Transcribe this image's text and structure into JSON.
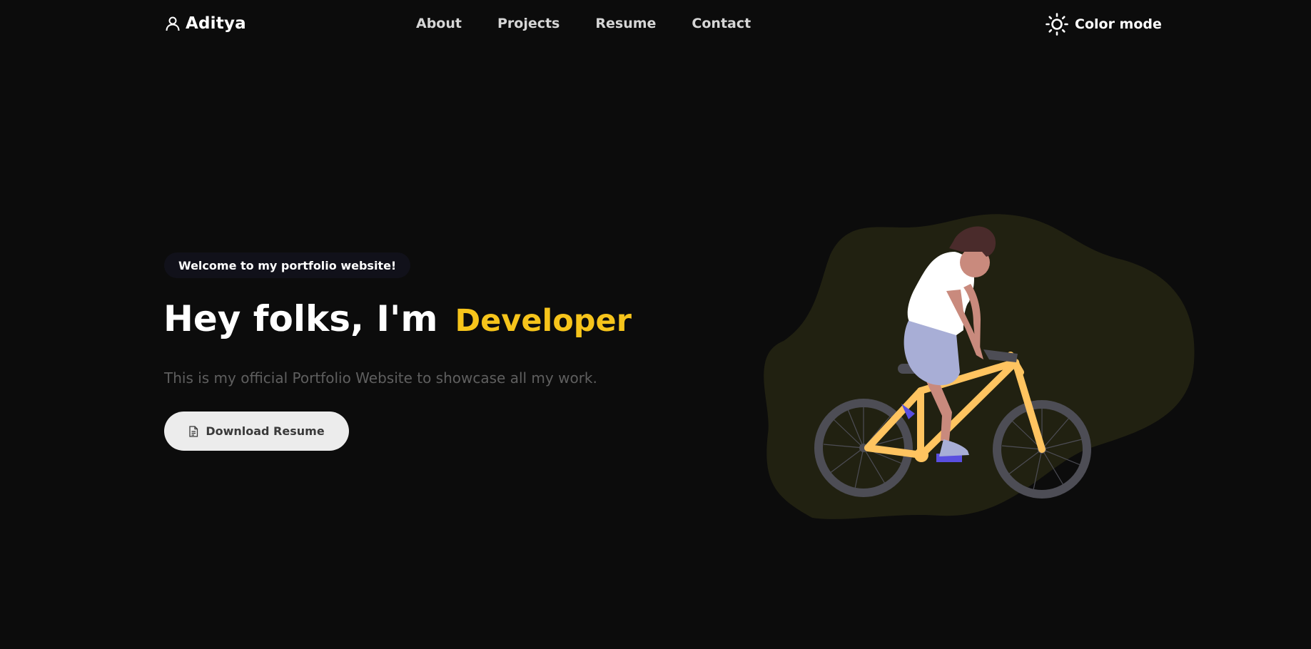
{
  "nav": {
    "brand": "Aditya",
    "links": [
      {
        "label": "About"
      },
      {
        "label": "Projects"
      },
      {
        "label": "Resume"
      },
      {
        "label": "Contact"
      }
    ],
    "color_mode_label": "Color mode",
    "icons": {
      "brand": "user-icon",
      "color_mode": "sun-icon"
    }
  },
  "hero": {
    "badge": "Welcome to my portfolio website!",
    "headline": "Hey folks, I'm",
    "role": "Developer",
    "subtitle": "This is my official Portfolio Website to showcase all my work.",
    "download_button": "Download Resume",
    "download_icon": "document-icon"
  },
  "illustration": {
    "subject": "person-riding-bicycle"
  },
  "colors": {
    "background": "#0c0c0c",
    "accent": "#f6c41b",
    "blob": "#212111",
    "bike_frame": "#ffc460",
    "button_bg": "#ececec"
  }
}
